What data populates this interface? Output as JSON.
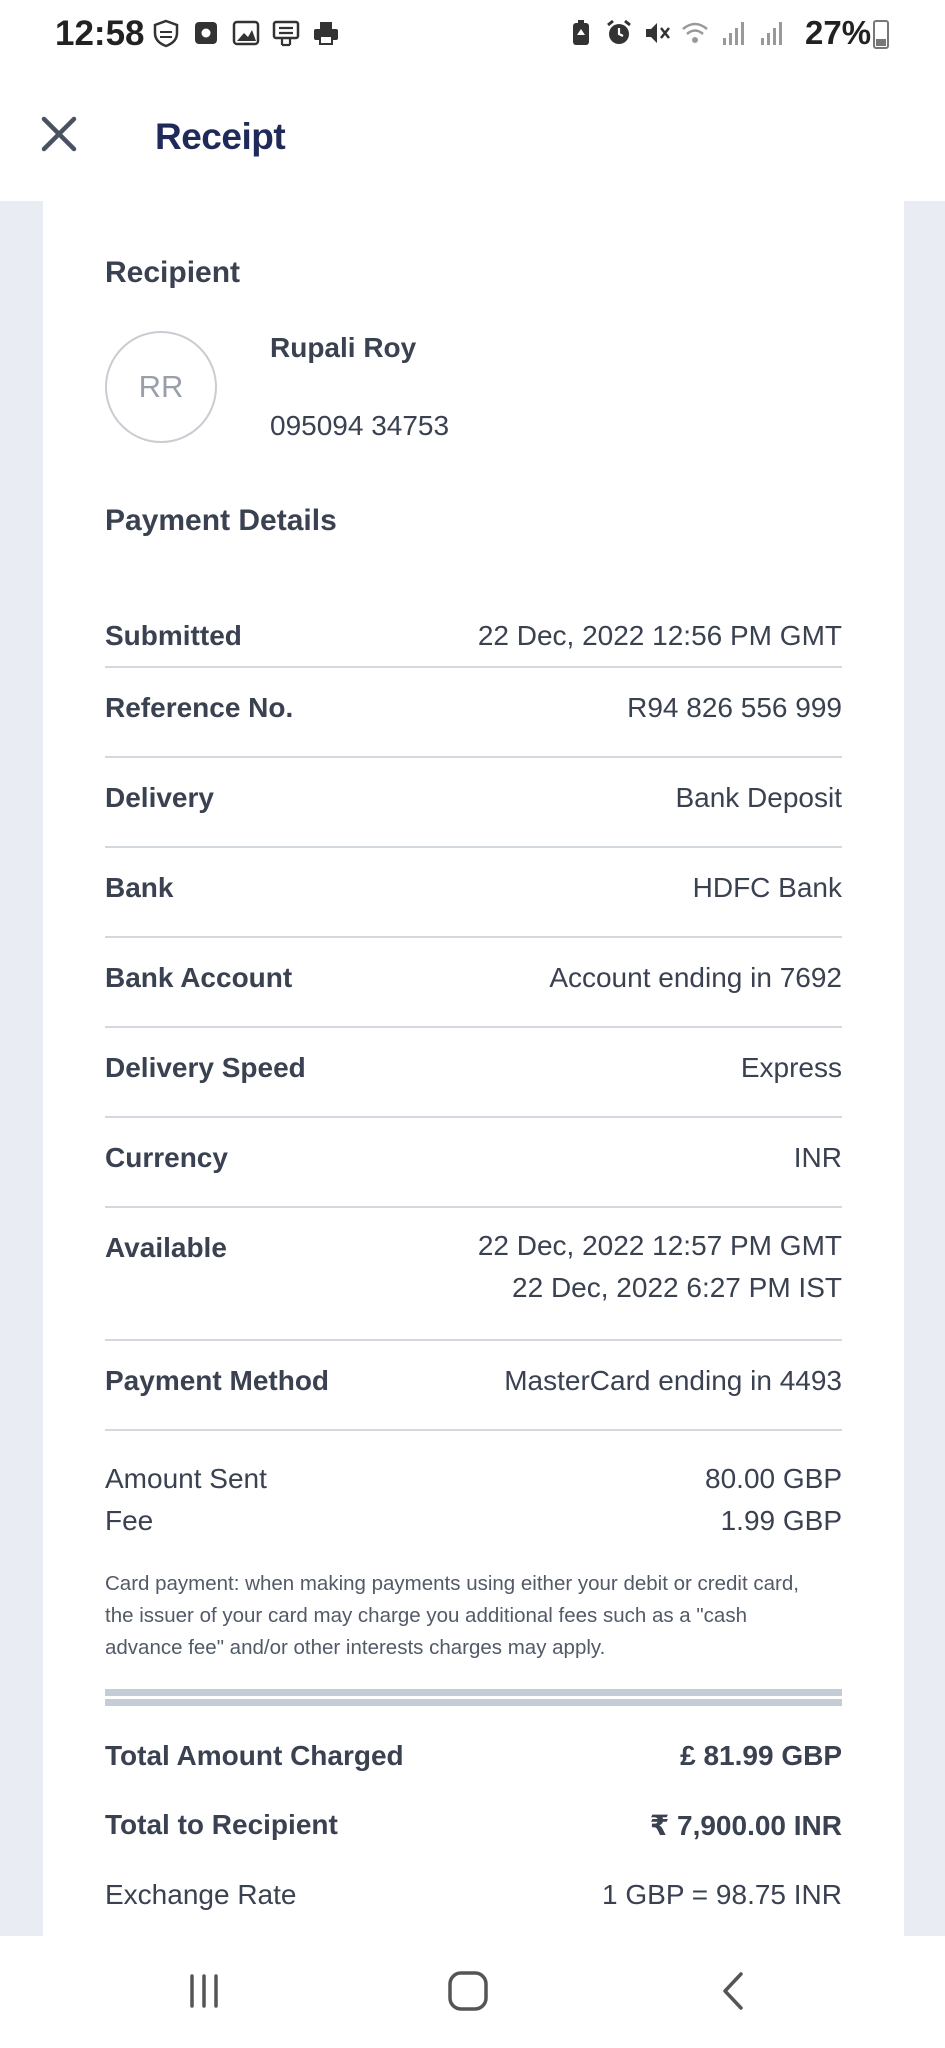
{
  "status_bar": {
    "time": "12:58",
    "battery_percent": "27%",
    "left_icons": [
      "shield-icon",
      "notification-icon",
      "gallery-icon",
      "news-icon",
      "print-icon"
    ],
    "right_icons": [
      "battery-saver-icon",
      "alarm-icon",
      "mute-icon",
      "wifi-icon",
      "signal-icon",
      "signal-icon"
    ]
  },
  "header": {
    "title": "Receipt",
    "close_icon": "close-icon"
  },
  "recipient": {
    "section_title": "Recipient",
    "initials": "RR",
    "name": "Rupali Roy",
    "phone": "095094 34753"
  },
  "payment_details": {
    "section_title": "Payment Details",
    "rows": [
      {
        "label": "Submitted",
        "value": "22 Dec, 2022 12:56 PM GMT"
      },
      {
        "label": "Reference No.",
        "value": "R94 826 556 999"
      },
      {
        "label": "Delivery",
        "value": "Bank Deposit"
      },
      {
        "label": "Bank",
        "value": "HDFC Bank"
      },
      {
        "label": "Bank Account",
        "value": "Account ending in 7692"
      },
      {
        "label": "Delivery Speed",
        "value": "Express"
      },
      {
        "label": "Currency",
        "value": "INR"
      },
      {
        "label": "Available",
        "value": "22 Dec, 2022 12:57 PM GMT",
        "value2": "22 Dec, 2022 6:27 PM IST"
      },
      {
        "label": "Payment Method",
        "value": "MasterCard ending in 4493"
      }
    ]
  },
  "amounts": {
    "amount_sent_label": "Amount Sent",
    "amount_sent_value": "80.00 GBP",
    "fee_label": "Fee",
    "fee_value": "1.99 GBP",
    "note": "Card payment: when making payments using either your debit or credit card, the issuer of your card may charge you additional fees such as a \"cash advance fee\" and/or other interests charges may apply."
  },
  "totals": {
    "total_charged_label": "Total Amount Charged",
    "total_charged_value": "£ 81.99 GBP",
    "total_recipient_label": "Total to Recipient",
    "total_recipient_value": "₹ 7,900.00 INR",
    "exchange_rate_label": "Exchange Rate",
    "exchange_rate_value": "1 GBP = 98.75 INR"
  },
  "nav_bar": {
    "buttons": [
      "recent-apps-icon",
      "home-icon",
      "back-icon"
    ]
  }
}
